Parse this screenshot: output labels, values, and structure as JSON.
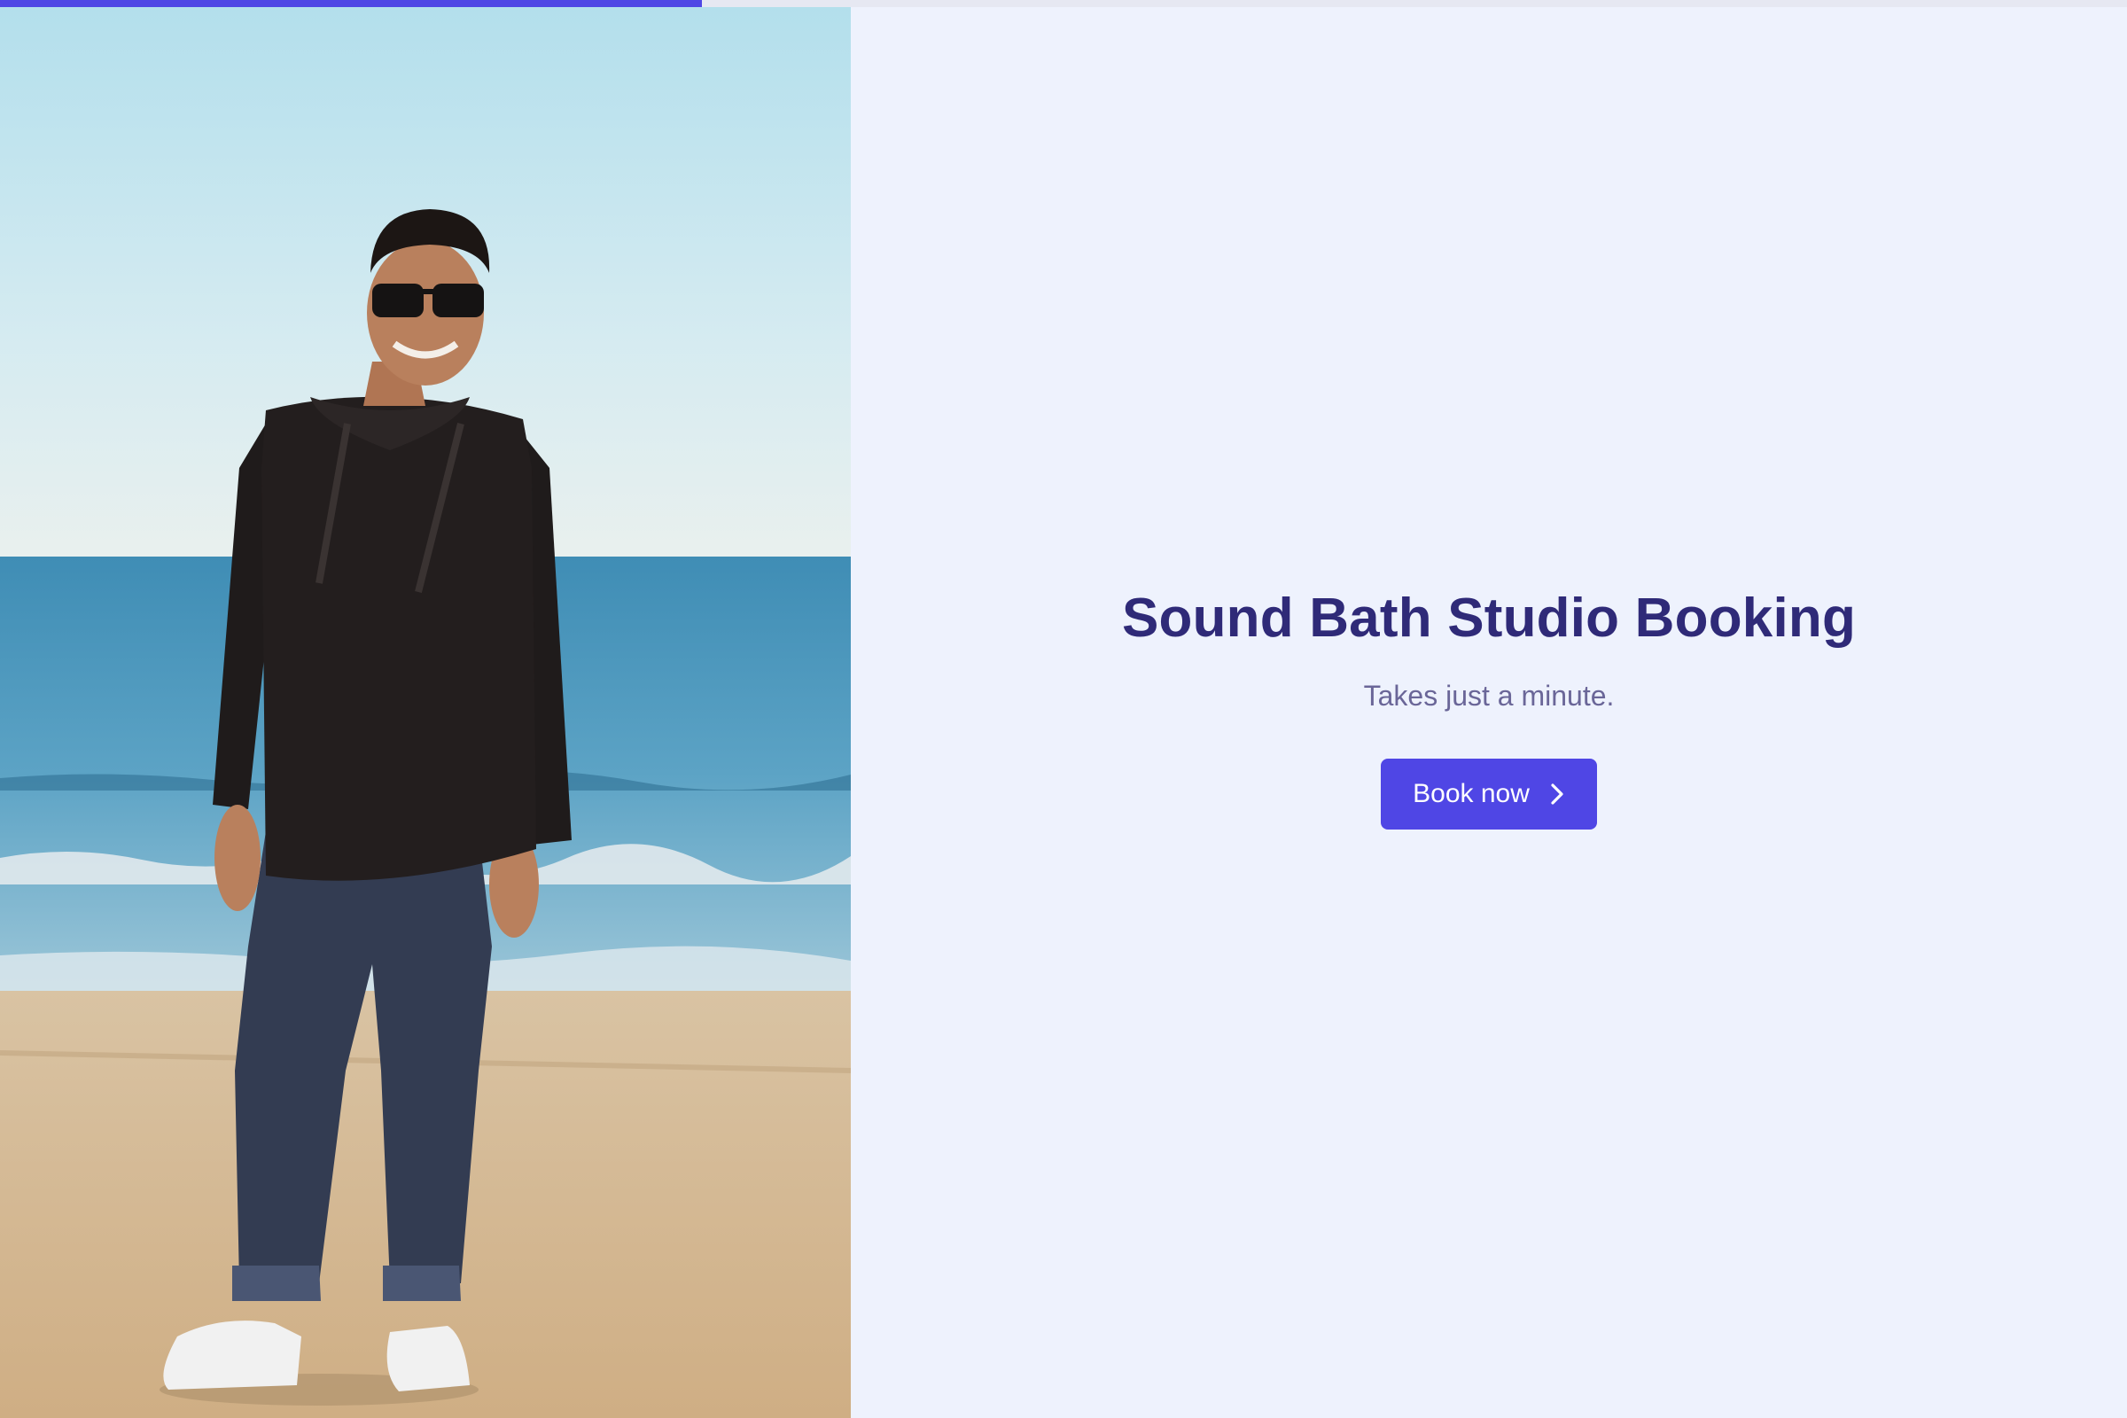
{
  "progress": {
    "value": 0.33
  },
  "hero": {
    "image": "photo of smiling man in sunglasses and black hoodie standing on beach",
    "icon": "person-photo"
  },
  "main": {
    "title": "Sound Bath Studio Booking",
    "subtitle": "Takes just a minute.",
    "cta_label": "Book now",
    "cta_icon": "chevron-right-icon"
  },
  "colors": {
    "accent": "#4f46e5",
    "background": "#eef2fd",
    "title": "#2f2a78",
    "subtitle": "#6a6698"
  }
}
